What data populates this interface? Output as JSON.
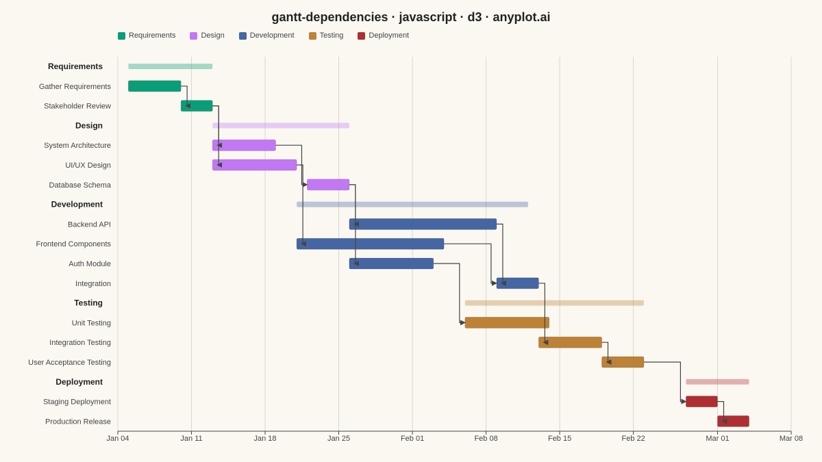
{
  "chart_data": {
    "type": "gantt",
    "title": "gantt-dependencies · javascript · d3 · anyplot.ai",
    "x_start": "2024-01-04",
    "x_end": "2024-03-08",
    "x_ticks": [
      {
        "date": "2024-01-04",
        "label": "Jan 04"
      },
      {
        "date": "2024-01-11",
        "label": "Jan 11"
      },
      {
        "date": "2024-01-18",
        "label": "Jan 18"
      },
      {
        "date": "2024-01-25",
        "label": "Jan 25"
      },
      {
        "date": "2024-02-01",
        "label": "Feb 01"
      },
      {
        "date": "2024-02-08",
        "label": "Feb 08"
      },
      {
        "date": "2024-02-15",
        "label": "Feb 15"
      },
      {
        "date": "2024-02-22",
        "label": "Feb 22"
      },
      {
        "date": "2024-03-01",
        "label": "Mar 01"
      },
      {
        "date": "2024-03-08",
        "label": "Mar 08"
      }
    ],
    "grid": true,
    "legend": [
      {
        "name": "Requirements",
        "color": "#0a9e78"
      },
      {
        "name": "Design",
        "color": "#c278f5"
      },
      {
        "name": "Development",
        "color": "#4666a3"
      },
      {
        "name": "Testing",
        "color": "#bd8236"
      },
      {
        "name": "Deployment",
        "color": "#ae2e33"
      }
    ],
    "rows": [
      {
        "label": "Requirements",
        "type": "group",
        "group": "Requirements",
        "start": "2024-01-05",
        "end": "2024-01-13"
      },
      {
        "id": "gather",
        "label": "Gather Requirements",
        "type": "task",
        "group": "Requirements",
        "start": "2024-01-05",
        "end": "2024-01-10"
      },
      {
        "id": "stake",
        "label": "Stakeholder Review",
        "type": "task",
        "group": "Requirements",
        "start": "2024-01-10",
        "end": "2024-01-13"
      },
      {
        "label": "Design",
        "type": "group",
        "group": "Design",
        "start": "2024-01-13",
        "end": "2024-01-26"
      },
      {
        "id": "sysarch",
        "label": "System Architecture",
        "type": "task",
        "group": "Design",
        "start": "2024-01-13",
        "end": "2024-01-19"
      },
      {
        "id": "uiux",
        "label": "UI/UX Design",
        "type": "task",
        "group": "Design",
        "start": "2024-01-13",
        "end": "2024-01-21"
      },
      {
        "id": "dbschema",
        "label": "Database Schema",
        "type": "task",
        "group": "Design",
        "start": "2024-01-22",
        "end": "2024-01-26"
      },
      {
        "label": "Development",
        "type": "group",
        "group": "Development",
        "start": "2024-01-21",
        "end": "2024-02-12"
      },
      {
        "id": "backend",
        "label": "Backend API",
        "type": "task",
        "group": "Development",
        "start": "2024-01-26",
        "end": "2024-02-09"
      },
      {
        "id": "frontend",
        "label": "Frontend Components",
        "type": "task",
        "group": "Development",
        "start": "2024-01-21",
        "end": "2024-02-04"
      },
      {
        "id": "auth",
        "label": "Auth Module",
        "type": "task",
        "group": "Development",
        "start": "2024-01-26",
        "end": "2024-02-03"
      },
      {
        "id": "integ",
        "label": "Integration",
        "type": "task",
        "group": "Development",
        "start": "2024-02-09",
        "end": "2024-02-13"
      },
      {
        "label": "Testing",
        "type": "group",
        "group": "Testing",
        "start": "2024-02-06",
        "end": "2024-02-23"
      },
      {
        "id": "unit",
        "label": "Unit Testing",
        "type": "task",
        "group": "Testing",
        "start": "2024-02-06",
        "end": "2024-02-14"
      },
      {
        "id": "integtest",
        "label": "Integration Testing",
        "type": "task",
        "group": "Testing",
        "start": "2024-02-13",
        "end": "2024-02-19"
      },
      {
        "id": "uat",
        "label": "User Acceptance Testing",
        "type": "task",
        "group": "Testing",
        "start": "2024-02-19",
        "end": "2024-02-23"
      },
      {
        "label": "Deployment",
        "type": "group",
        "group": "Deployment",
        "start": "2024-02-27",
        "end": "2024-03-04"
      },
      {
        "id": "staging",
        "label": "Staging Deployment",
        "type": "task",
        "group": "Deployment",
        "start": "2024-02-27",
        "end": "2024-03-01"
      },
      {
        "id": "prod",
        "label": "Production Release",
        "type": "task",
        "group": "Deployment",
        "start": "2024-03-01",
        "end": "2024-03-04"
      }
    ],
    "dependencies": [
      {
        "from": "gather",
        "to": "stake"
      },
      {
        "from": "stake",
        "to": "sysarch"
      },
      {
        "from": "stake",
        "to": "uiux"
      },
      {
        "from": "sysarch",
        "to": "dbschema"
      },
      {
        "from": "uiux",
        "to": "frontend"
      },
      {
        "from": "dbschema",
        "to": "backend"
      },
      {
        "from": "dbschema",
        "to": "auth"
      },
      {
        "from": "frontend",
        "to": "integ"
      },
      {
        "from": "backend",
        "to": "integ"
      },
      {
        "from": "auth",
        "to": "unit"
      },
      {
        "from": "integ",
        "to": "integtest"
      },
      {
        "from": "integtest",
        "to": "uat"
      },
      {
        "from": "uat",
        "to": "staging"
      },
      {
        "from": "staging",
        "to": "prod"
      }
    ]
  }
}
